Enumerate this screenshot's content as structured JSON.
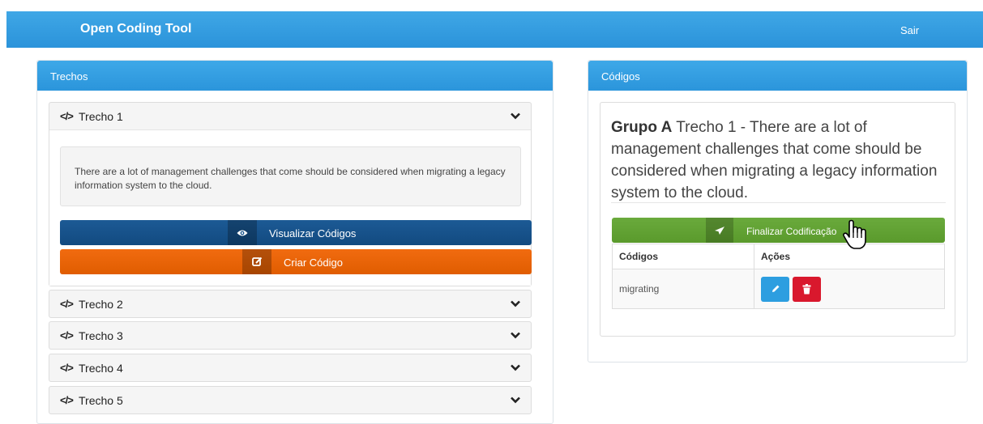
{
  "navbar": {
    "brand": "Open Coding Tool",
    "logout": "Sair"
  },
  "left_panel": {
    "title": "Trechos",
    "items": [
      {
        "label": "Trecho 1",
        "expanded": true,
        "text": "There are a lot of management challenges that come should be considered when migrating a legacy information system to the cloud.",
        "view_button": "Visualizar Códigos",
        "create_button": "Criar Código"
      },
      {
        "label": "Trecho 2",
        "expanded": false
      },
      {
        "label": "Trecho 3",
        "expanded": false
      },
      {
        "label": "Trecho 4",
        "expanded": false
      },
      {
        "label": "Trecho 5",
        "expanded": false
      }
    ]
  },
  "right_panel": {
    "title": "Códigos",
    "group": "Grupo A",
    "excerpt": "Trecho 1 - There are a lot of management challenges that come should be considered when migrating a legacy information system to the cloud.",
    "finish_button": "Finalizar Codificação",
    "table": {
      "headers": [
        "Códigos",
        "Ações"
      ],
      "rows": [
        {
          "code": "migrating"
        }
      ]
    }
  },
  "colors": {
    "primary": "#2b93da",
    "blue_btn": "#124a80",
    "orange_btn": "#e05d00",
    "green_btn": "#5a9a2c",
    "delete": "#d9182d"
  },
  "icons": [
    "code-icon",
    "chevron-down-icon",
    "eye-icon",
    "edit-square-icon",
    "send-icon",
    "pencil-icon",
    "trash-icon",
    "hand-cursor-icon"
  ]
}
